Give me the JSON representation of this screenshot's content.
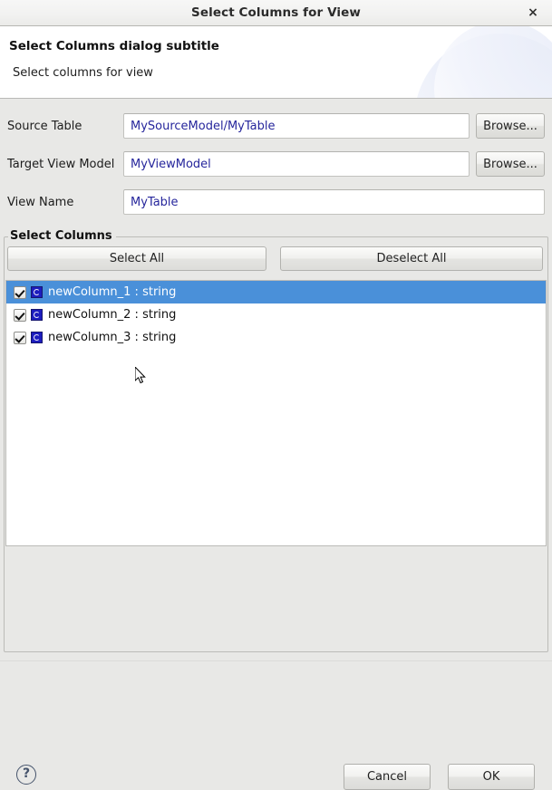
{
  "window": {
    "title": "Select Columns for View",
    "close_label": "×"
  },
  "header": {
    "title": "Select Columns dialog subtitle",
    "subtitle": "Select columns for view"
  },
  "form": {
    "rows": [
      {
        "label": "Source Table",
        "value": "MySourceModel/MyTable",
        "placeholder": "",
        "browse_label": "Browse..."
      },
      {
        "label": "Target View Model",
        "value": "MyViewModel",
        "placeholder": "",
        "browse_label": "Browse..."
      },
      {
        "label": "View Name",
        "value": "MyTable",
        "placeholder": "",
        "browse_label": ""
      }
    ]
  },
  "group": {
    "title": "Select Columns",
    "select_all_label": "Select All",
    "deselect_all_label": "Deselect All",
    "columns": [
      {
        "label": "newColumn_1 : string",
        "checked": true,
        "selected": true
      },
      {
        "label": "newColumn_2 : string",
        "checked": true,
        "selected": false
      },
      {
        "label": "newColumn_3 : string",
        "checked": true,
        "selected": false
      }
    ]
  },
  "footer": {
    "help_label": "?",
    "cancel_label": "Cancel",
    "ok_label": "OK"
  },
  "colors": {
    "selection": "#4a90d9",
    "input_text": "#26269c",
    "dialog_bg": "#e8e8e6"
  }
}
